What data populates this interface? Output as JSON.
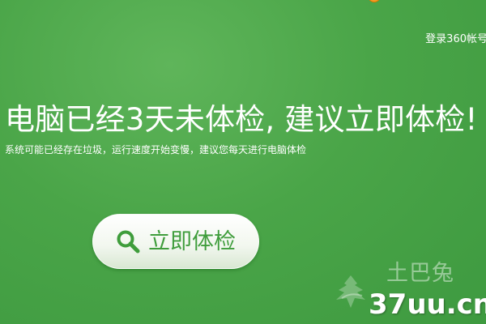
{
  "header": {
    "login_link": "登录360帐号"
  },
  "main": {
    "headline": "电脑已经3天未体检, 建议立即体检!",
    "subtitle": "系统可能已经存在垃圾，运行速度开始变慢，建议您每天进行电脑体检",
    "primary_button": {
      "label": "立即体检",
      "icon": "search-icon"
    }
  },
  "watermark": {
    "small_text": "土巴兔",
    "domain": "37uu.cn"
  },
  "colors": {
    "background": "#4aa548",
    "button_text": "#3f9d3c",
    "text": "#ffffff"
  }
}
